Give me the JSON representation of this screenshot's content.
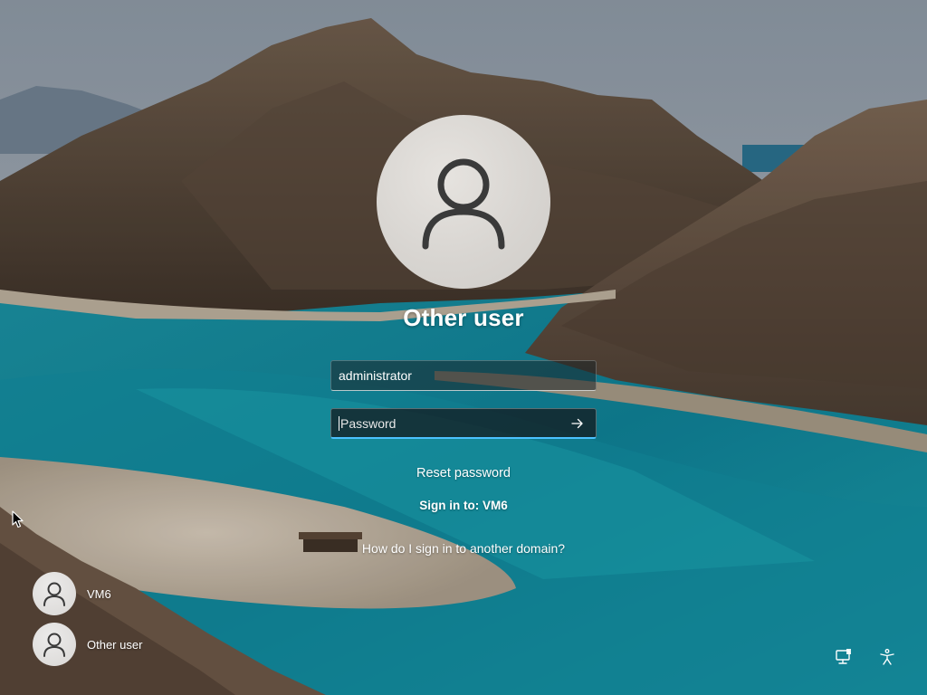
{
  "login": {
    "title": "Other user",
    "username_value": "administrator",
    "password_placeholder": "Password",
    "reset_password": "Reset password",
    "sign_in_to": "Sign in to: VM6",
    "other_domain": "How do I sign in to another domain?"
  },
  "user_list": [
    {
      "name": "VM6",
      "icon": "person-icon"
    },
    {
      "name": "Other user",
      "icon": "person-icon"
    }
  ],
  "corner_icons": [
    {
      "name": "network-icon"
    },
    {
      "name": "accessibility-icon"
    }
  ],
  "colors": {
    "focus_accent": "#4cc2ff",
    "avatar_bg": "#d8d5d1",
    "avatar_glyph": "#3a3a3a"
  }
}
